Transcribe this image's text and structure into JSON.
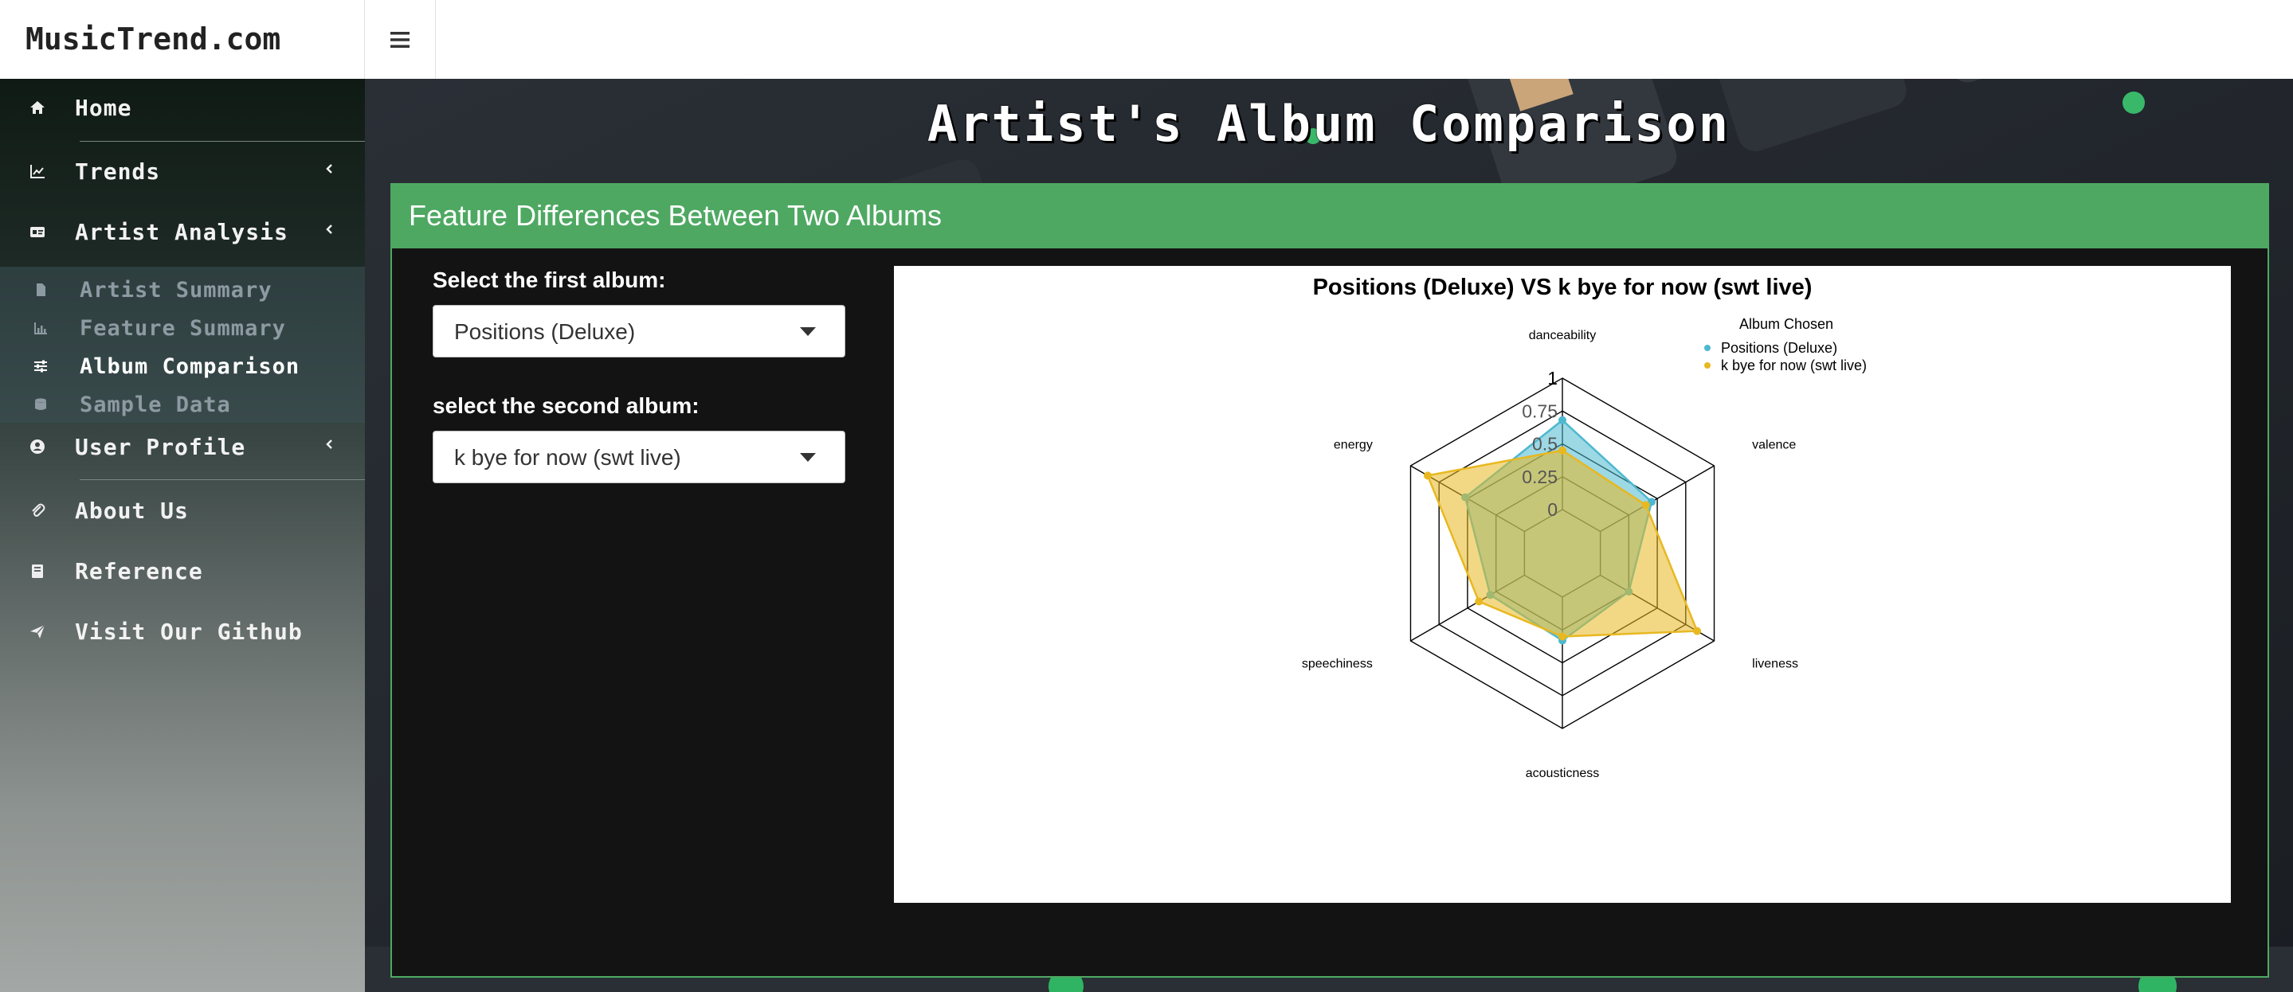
{
  "header": {
    "logo": "MusicTrend.com",
    "toggle_icon": "hamburger-icon"
  },
  "sidebar": {
    "items": [
      {
        "label": "Home",
        "icon": "home-icon"
      },
      {
        "label": "Trends",
        "icon": "line-chart-icon"
      },
      {
        "label": "Artist Analysis",
        "icon": "id-card-icon"
      },
      {
        "label": "User Profile",
        "icon": "user-circle-icon"
      },
      {
        "label": "About Us",
        "icon": "paperclip-icon"
      },
      {
        "label": "Reference",
        "icon": "book-icon"
      },
      {
        "label": "Visit Our Github",
        "icon": "send-icon"
      }
    ],
    "sub_items": [
      {
        "label": "Artist Summary",
        "icon": "file-icon"
      },
      {
        "label": "Feature Summary",
        "icon": "bar-chart-icon"
      },
      {
        "label": "Album Comparison",
        "icon": "sliders-icon",
        "active": true
      },
      {
        "label": "Sample Data",
        "icon": "database-icon"
      }
    ]
  },
  "main": {
    "page_title": "Artist's Album Comparison",
    "box_title": "Feature Differences Between Two Albums",
    "first_album": {
      "label": "Select the first album:",
      "value": "Positions (Deluxe)"
    },
    "second_album": {
      "label": "select the second album:",
      "value": "k bye for now (swt live)"
    }
  },
  "colors": {
    "accent_green": "#4ea862",
    "series1": "#4db8cf",
    "series2": "#e8b820"
  },
  "chart_data": {
    "type": "radar",
    "title": "Positions (Deluxe) VS k bye for now (swt live)",
    "axes": [
      "danceability",
      "valence",
      "liveness",
      "acousticness",
      "speechiness",
      "energy"
    ],
    "ticks": [
      "0",
      "0.25",
      "0.5",
      "0.75",
      "1"
    ],
    "range": [
      0,
      1
    ],
    "legend_title": "Album Chosen",
    "legend_position": "top-right",
    "series": [
      {
        "name": "Positions (Deluxe)",
        "values": [
          0.68,
          0.45,
          0.25,
          0.33,
          0.3,
          0.52
        ]
      },
      {
        "name": "k bye for now (swt live)",
        "values": [
          0.45,
          0.4,
          0.85,
          0.3,
          0.4,
          0.85
        ]
      }
    ]
  }
}
